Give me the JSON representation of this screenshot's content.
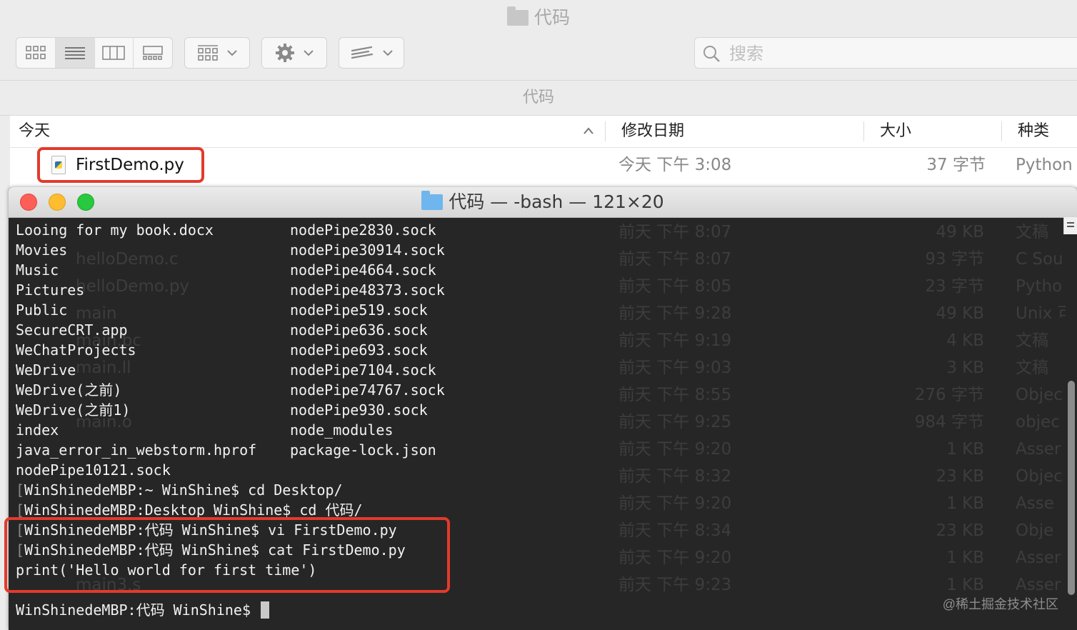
{
  "finder": {
    "title": "代码",
    "path_label": "代码",
    "search_placeholder": "搜索",
    "columns": {
      "name": "今天",
      "date": "修改日期",
      "size": "大小",
      "kind": "种类"
    },
    "file": {
      "name": "FirstDemo.py",
      "date": "今天 下午 3:08",
      "size": "37 字节",
      "kind": "Python"
    },
    "background_rows": [
      {
        "name": "",
        "date": "前天 下午 8:07",
        "size": "49 KB",
        "kind": "文稿"
      },
      {
        "name": "helloDemo.c",
        "date": "前天 下午 8:07",
        "size": "93 字节",
        "kind": "C Sou"
      },
      {
        "name": "helloDemo.py",
        "date": "前天 下午 8:05",
        "size": "23 字节",
        "kind": "Pytho"
      },
      {
        "name": "main",
        "date": "前天 下午 9:28",
        "size": "49 KB",
        "kind": "Unix 可"
      },
      {
        "name": "main.bc",
        "date": "前天 下午 9:19",
        "size": "4 KB",
        "kind": "文稿"
      },
      {
        "name": "main.ll",
        "date": "前天 下午 9:03",
        "size": "3 KB",
        "kind": "文稿"
      },
      {
        "name": "",
        "date": "前天 下午 8:55",
        "size": "276 字节",
        "kind": "Objec"
      },
      {
        "name": "main.o",
        "date": "前天 下午 9:25",
        "size": "984 字节",
        "kind": "objec"
      },
      {
        "name": "",
        "date": "前天 下午 9:20",
        "size": "1 KB",
        "kind": "Asser"
      },
      {
        "name": "",
        "date": "前天 下午 8:32",
        "size": "23 KB",
        "kind": "Objec"
      },
      {
        "name": "",
        "date": "前天 下午 9:20",
        "size": "1 KB",
        "kind": "Asse"
      },
      {
        "name": "",
        "date": "前天 下午 8:34",
        "size": "23 KB",
        "kind": "Obje"
      },
      {
        "name": "",
        "date": "前天 下午 9:20",
        "size": "1 KB",
        "kind": "Asser"
      },
      {
        "name": "main3.s",
        "date": "前天 下午 9:23",
        "size": "1 KB",
        "kind": "Asser"
      }
    ]
  },
  "terminal": {
    "title": "代码 — -bash — 121×20",
    "listing": [
      {
        "left": "Looing for my book.docx",
        "right": "nodePipe2830.sock"
      },
      {
        "left": "Movies",
        "right": "nodePipe30914.sock"
      },
      {
        "left": "Music",
        "right": "nodePipe4664.sock"
      },
      {
        "left": "Pictures",
        "right": "nodePipe48373.sock"
      },
      {
        "left": "Public",
        "right": "nodePipe519.sock"
      },
      {
        "left": "SecureCRT.app",
        "right": "nodePipe636.sock"
      },
      {
        "left": "WeChatProjects",
        "right": "nodePipe693.sock"
      },
      {
        "left": "WeDrive",
        "right": "nodePipe7104.sock"
      },
      {
        "left": "WeDrive(之前)",
        "right": "nodePipe74767.sock"
      },
      {
        "left": "WeDrive(之前1)",
        "right": "nodePipe930.sock"
      },
      {
        "left": "index",
        "right": "node_modules"
      },
      {
        "left": "java_error_in_webstorm.hprof",
        "right": "package-lock.json"
      },
      {
        "left": "nodePipe10121.sock",
        "right": ""
      }
    ],
    "commands": [
      "WinShinedeMBP:~ WinShine$ cd Desktop/",
      "WinShinedeMBP:Desktop WinShine$ cd 代码/",
      "WinShinedeMBP:代码 WinShine$ vi FirstDemo.py",
      "WinShinedeMBP:代码 WinShine$ cat FirstDemo.py"
    ],
    "output": "print('Hello world for first time')",
    "prompt": "WinShinedeMBP:代码 WinShine$ "
  },
  "watermark": "@稀土掘金技术社区",
  "colors": {
    "highlight": "#e33a2c",
    "terminal_bg": "#262626",
    "close": "#fd5f57",
    "minimize": "#febc2e",
    "zoom": "#28c840"
  }
}
